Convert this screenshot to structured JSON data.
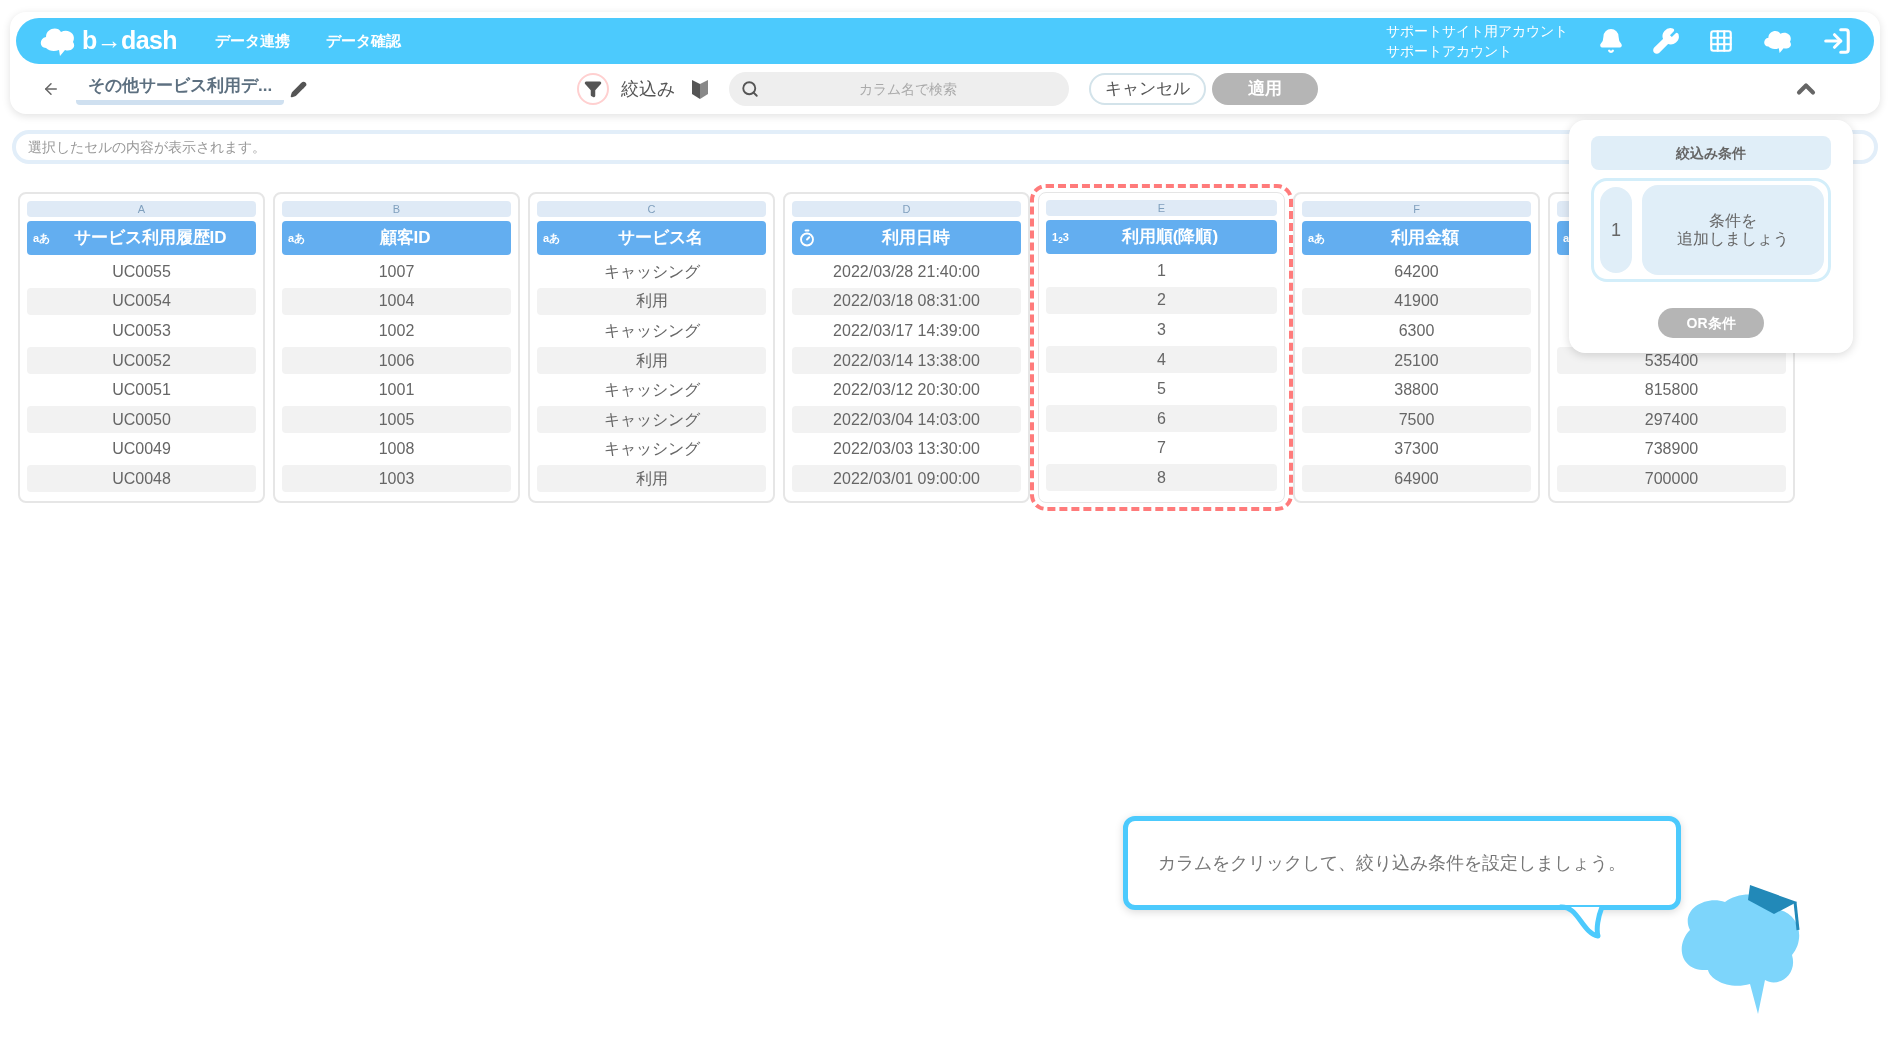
{
  "header": {
    "logo_text": "b→dash",
    "nav": [
      {
        "label": "データ連携"
      },
      {
        "label": "データ確認"
      }
    ],
    "account": [
      "サポートサイト用アカウント",
      "サポートアカウント"
    ]
  },
  "toolbar": {
    "title": "その他サービス利用デ...",
    "filter_label": "絞込み",
    "search": {
      "placeholder": "カラム名で検索"
    },
    "buttons": [
      {
        "label": "キャンセル",
        "disabled": false
      },
      {
        "label": "適用",
        "disabled": true
      }
    ]
  },
  "cell_viewer": {
    "placeholder": "選択したセルの内容が表示されます。"
  },
  "table": {
    "columns": [
      {
        "letter": "A",
        "kind": "text",
        "type_label": "aあ",
        "label": "サービス利用履歴ID",
        "selected": false,
        "cells": [
          "UC0055",
          "UC0054",
          "UC0053",
          "UC0052",
          "UC0051",
          "UC0050",
          "UC0049",
          "UC0048"
        ]
      },
      {
        "letter": "B",
        "kind": "text",
        "type_label": "aあ",
        "label": "顧客ID",
        "selected": false,
        "cells": [
          "1007",
          "1004",
          "1002",
          "1006",
          "1001",
          "1005",
          "1008",
          "1003"
        ]
      },
      {
        "letter": "C",
        "kind": "text",
        "type_label": "aあ",
        "label": "サービス名",
        "selected": false,
        "cells": [
          "キャッシング",
          "利用",
          "キャッシング",
          "利用",
          "キャッシング",
          "キャッシング",
          "キャッシング",
          "利用"
        ]
      },
      {
        "letter": "D",
        "kind": "datetime",
        "label": "利用日時",
        "selected": false,
        "cells": [
          "2022/03/28 21:40:00",
          "2022/03/18 08:31:00",
          "2022/03/17 14:39:00",
          "2022/03/14 13:38:00",
          "2022/03/12 20:30:00",
          "2022/03/04 14:03:00",
          "2022/03/03 13:30:00",
          "2022/03/01 09:00:00"
        ]
      },
      {
        "letter": "E",
        "kind": "number",
        "type_label": "1$_{2}$3",
        "label": "利用順(降順)",
        "selected": true,
        "cells": [
          "1",
          "2",
          "3",
          "4",
          "5",
          "6",
          "7",
          "8"
        ]
      },
      {
        "letter": "F",
        "kind": "text",
        "type_label": "aあ",
        "label": "利用金額",
        "selected": false,
        "cells": [
          "64200",
          "41900",
          "6300",
          "25100",
          "38800",
          "7500",
          "37300",
          "64900"
        ]
      },
      {
        "kind": "text",
        "type_label": "a",
        "selected": false,
        "cells": [
          null,
          null,
          null,
          "535400",
          "815800",
          "297400",
          "738900",
          "700000"
        ]
      }
    ]
  },
  "filter_panel": {
    "title": "絞込み条件",
    "conditions": [
      {
        "index": "1",
        "lines": [
          "条件を",
          "追加しましょう"
        ]
      }
    ],
    "or_button": {
      "label": "OR条件",
      "disabled": true
    }
  },
  "hint": {
    "text": "カラムをクリックして、絞り込み条件を設定しましょう。"
  }
}
